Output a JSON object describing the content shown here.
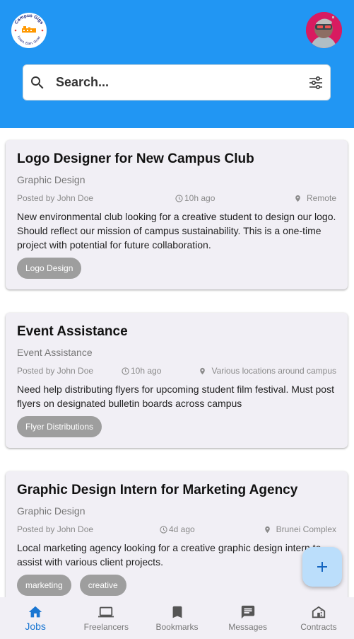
{
  "header": {
    "logo_text_top": "Campus Gigs",
    "logo_text_bottom": "Learn. Earn. Grow.",
    "search_placeholder": "Search..."
  },
  "jobs": [
    {
      "title": "Logo Designer for New Campus Club",
      "category": "Graphic Design",
      "posted_by": "Posted by John Doe",
      "time": "10h ago",
      "location": "Remote",
      "description": "New environmental club looking for a creative student to design our logo. Should reflect our mission of campus sustainability. This is a one-time project with potential for future collaboration.",
      "tags": [
        "Logo Design"
      ]
    },
    {
      "title": "Event Assistance",
      "category": "Event Assistance",
      "posted_by": "Posted by John Doe",
      "time": "10h ago",
      "location": "Various locations around campus",
      "description": "Need help distributing flyers for upcoming student film festival. Must post flyers on designated bulletin boards across campus",
      "tags": [
        "Flyer Distributions"
      ]
    },
    {
      "title": "Graphic Design Intern for Marketing Agency",
      "category": "Graphic Design",
      "posted_by": "Posted by John Doe",
      "time": "4d ago",
      "location": "Brunei Complex",
      "description": "Local marketing agency looking for a creative graphic design intern to assist with various client projects.",
      "tags": [
        "marketing",
        "creative"
      ]
    }
  ],
  "nav": {
    "items": [
      {
        "label": "Jobs",
        "icon": "home-icon",
        "active": true
      },
      {
        "label": "Freelancers",
        "icon": "laptop-icon",
        "active": false
      },
      {
        "label": "Bookmarks",
        "icon": "bookmark-icon",
        "active": false
      },
      {
        "label": "Messages",
        "icon": "message-icon",
        "active": false
      },
      {
        "label": "Contracts",
        "icon": "building-icon",
        "active": false
      }
    ]
  },
  "colors": {
    "primary": "#2196f3",
    "active_nav": "#1976d2",
    "card_bg": "#f1eff5",
    "tag_bg": "#9e9e9e",
    "fab_bg": "#bbdefb"
  }
}
